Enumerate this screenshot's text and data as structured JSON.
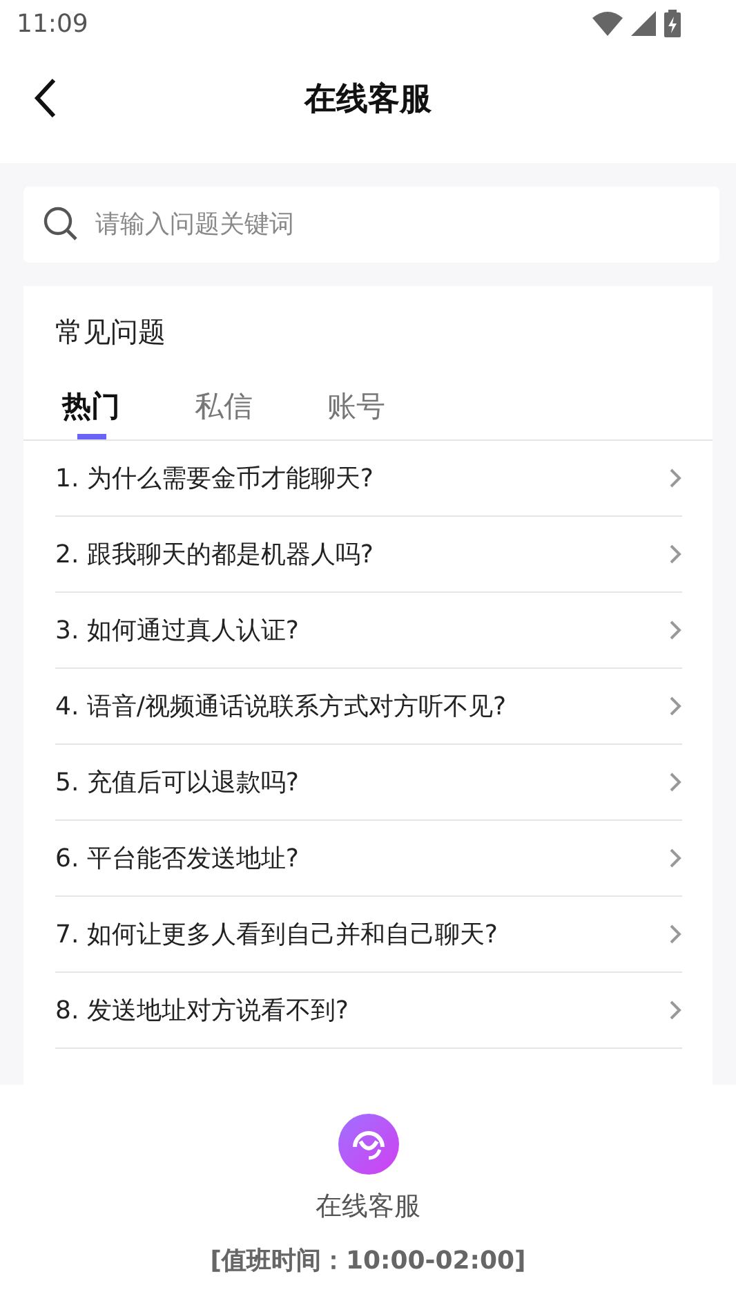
{
  "status_bar": {
    "time": "11:09"
  },
  "header": {
    "title": "在线客服"
  },
  "search": {
    "placeholder": "请输入问题关键词"
  },
  "faq": {
    "title": "常见问题",
    "tabs": [
      {
        "label": "热门",
        "selected": true
      },
      {
        "label": "私信",
        "selected": false
      },
      {
        "label": "账号",
        "selected": false
      }
    ],
    "questions": [
      "1. 为什么需要金币才能聊天?",
      "2. 跟我聊天的都是机器人吗?",
      "3. 如何通过真人认证?",
      "4. 语音/视频通话说联系方式对方听不见?",
      "5. 充值后可以退款吗?",
      "6. 平台能否发送地址?",
      "7. 如何让更多人看到自己并和自己聊天?",
      "8. 发送地址对方说看不到?"
    ]
  },
  "support": {
    "label": "在线客服",
    "hours": "[值班时间：10:00-02:00]"
  }
}
